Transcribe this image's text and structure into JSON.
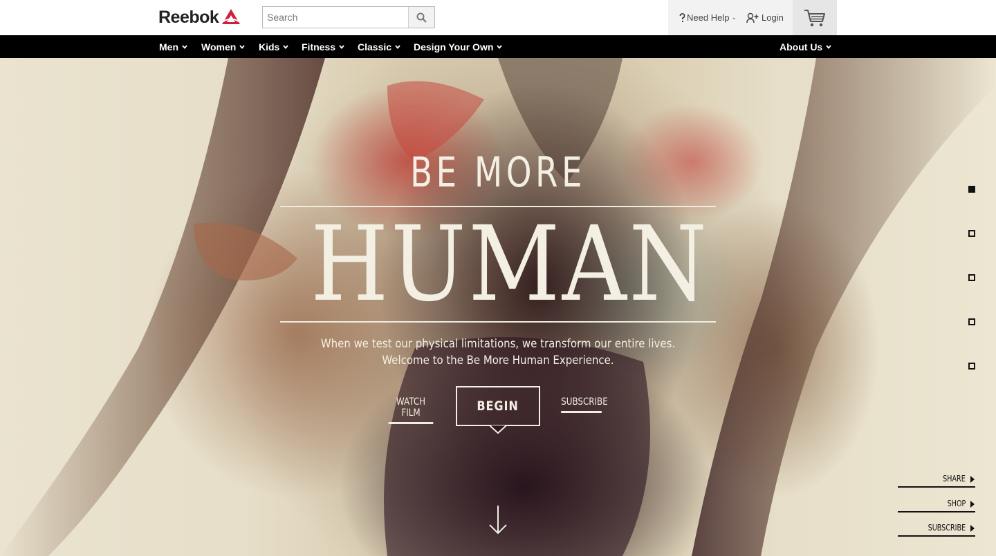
{
  "header": {
    "logo_text": "Reebok",
    "search_placeholder": "Search",
    "need_help": "Need Help",
    "login": "Login"
  },
  "nav": {
    "items": [
      "Men",
      "Women",
      "Kids",
      "Fitness",
      "Classic",
      "Design Your Own"
    ],
    "about": "About Us"
  },
  "hero": {
    "kicker": "BE MORE",
    "headline": "HUMAN",
    "tagline_1": "When we test our physical limitations, we transform our entire lives.",
    "tagline_2": "Welcome to the Be More Human Experience.",
    "watch_film": "WATCH FILM",
    "begin": "BEGIN",
    "subscribe": "SUBSCRIBE"
  },
  "side_nav": {
    "active_index": 0,
    "count": 5
  },
  "side_links": {
    "share": "SHARE",
    "shop": "SHOP",
    "subscribe": "SUBSCRIBE"
  },
  "colors": {
    "brand_red": "#cf1f3b",
    "nav_bg": "#000000",
    "hero_text": "#f3efe3"
  },
  "icons": {
    "logo_mark": "reebok-delta-icon",
    "search": "search-icon",
    "help": "question-icon",
    "login": "add-user-icon",
    "cart": "cart-icon",
    "scroll": "arrow-down-icon"
  }
}
